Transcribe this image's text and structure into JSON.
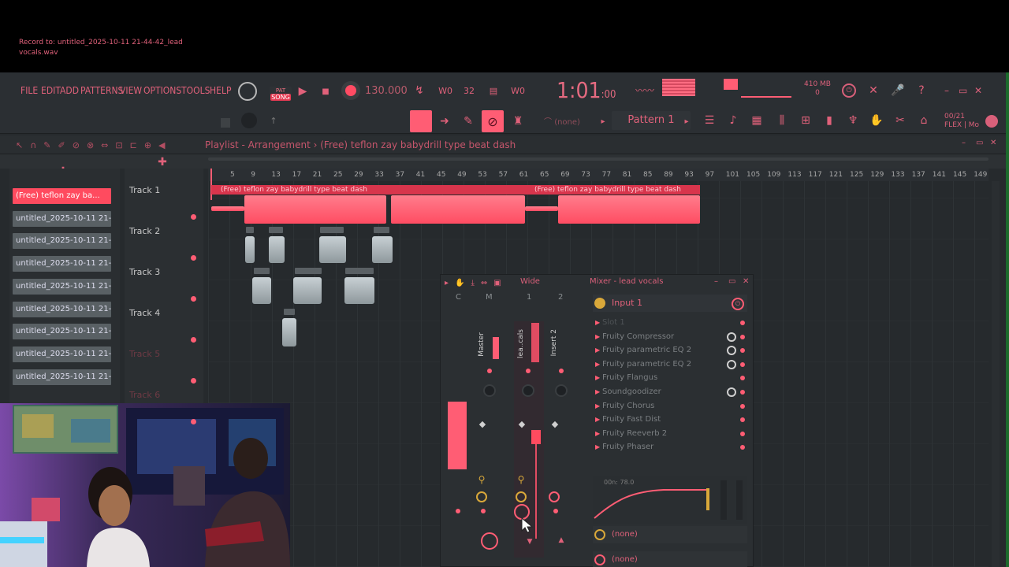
{
  "app": {
    "menu": [
      "FILE",
      "EDIT",
      "ADD",
      "PATTERNS",
      "VIEW",
      "OPTIONS",
      "TOOLS",
      "HELP"
    ],
    "record_hint": "Record to: untitled_2025-10-11 21-44-42_lead vocals.wav",
    "song_mode_label": "SONG",
    "tempo": "130.000",
    "time_main": "1:01",
    "time_sub": ":00",
    "cpu_top": "410 MB",
    "cpu_bottom": "0",
    "none_label": "(none)",
    "pattern_label": "Pattern 1",
    "flex_label": "FLEX | Mo"
  },
  "playlist": {
    "title": "Playlist - Arrangement › (Free) teflon zay babydrill type beat dash",
    "ruler": [
      "5",
      "9",
      "13",
      "17",
      "21",
      "25",
      "29",
      "33",
      "37",
      "41",
      "45",
      "49",
      "53",
      "57",
      "61",
      "65",
      "69",
      "73",
      "77",
      "81",
      "85",
      "89",
      "93",
      "97",
      "101",
      "105",
      "109",
      "113",
      "117",
      "121",
      "125",
      "129",
      "133",
      "137",
      "141",
      "145",
      "149"
    ],
    "tracks": [
      {
        "name": "Track 1",
        "dim": false
      },
      {
        "name": "Track 2",
        "dim": false
      },
      {
        "name": "Track 3",
        "dim": false
      },
      {
        "name": "Track 4",
        "dim": false
      },
      {
        "name": "Track 5",
        "dim": true
      },
      {
        "name": "Track 6",
        "dim": true
      }
    ],
    "clip_label": "(Free) teflon zay  babydrill type beat dash",
    "patterns": [
      {
        "label": "(Free) teflon zay ba...",
        "selected": true
      },
      {
        "label": "untitled_2025-10-11 21-...",
        "selected": false
      },
      {
        "label": "untitled_2025-10-11 21-...",
        "selected": false
      },
      {
        "label": "untitled_2025-10-11 21-...",
        "selected": false
      },
      {
        "label": "untitled_2025-10-11 21-...",
        "selected": false
      },
      {
        "label": "untitled_2025-10-11 21-...",
        "selected": false
      },
      {
        "label": "untitled_2025-10-11 21-...",
        "selected": false
      },
      {
        "label": "untitled_2025-10-11 21-...",
        "selected": false
      },
      {
        "label": "untitled_2025-10-11 21-...",
        "selected": false
      }
    ]
  },
  "mixer": {
    "title": "Mixer - lead vocals",
    "mode": "Wide",
    "channel_headers": [
      "C",
      "M",
      "1",
      "2"
    ],
    "channels": [
      "Master",
      "lea..cals",
      "Insert 2"
    ],
    "input": "Input 1",
    "slots": [
      {
        "label": "Slot 1",
        "ring": false
      },
      {
        "label": "Fruity Compressor",
        "ring": true
      },
      {
        "label": "Fruity parametric EQ 2",
        "ring": true
      },
      {
        "label": "Fruity parametric EQ 2",
        "ring": true
      },
      {
        "label": "Fruity Flangus",
        "ring": false
      },
      {
        "label": "Soundgoodizer",
        "ring": true
      },
      {
        "label": "Fruity Chorus",
        "ring": false
      },
      {
        "label": "Fruity Fast Dist",
        "ring": false
      },
      {
        "label": "Fruity Reeverb 2",
        "ring": false
      },
      {
        "label": "Fruity Phaser",
        "ring": false
      }
    ],
    "eq_label": "00n: 78.0",
    "outputs": [
      "(none)",
      "(none)"
    ]
  },
  "colors": {
    "accent": "#ff5d74",
    "bg": "#262a2d"
  }
}
